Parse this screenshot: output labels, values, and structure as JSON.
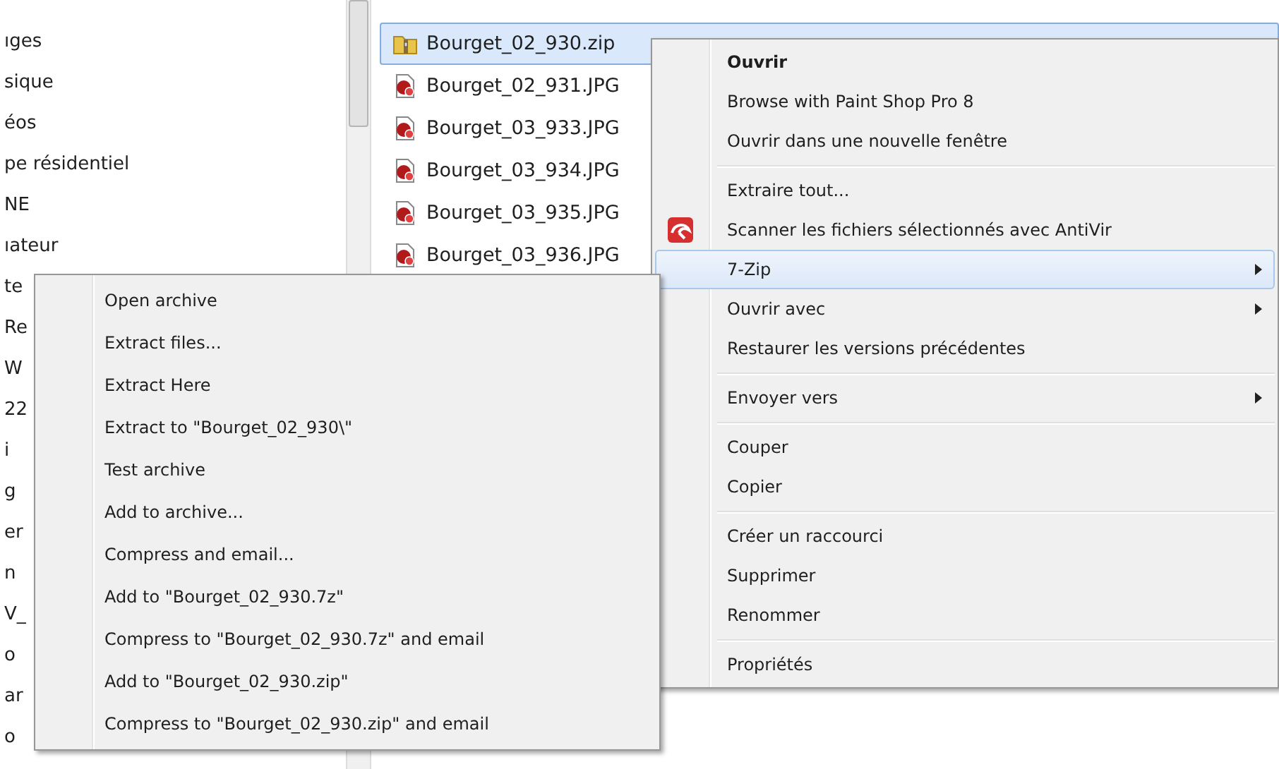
{
  "sidebar": {
    "items": [
      {
        "label": "ıges"
      },
      {
        "label": "sique"
      },
      {
        "label": "éos"
      },
      {
        "label": "pe résidentiel"
      },
      {
        "label": "NE"
      },
      {
        "label": "ıateur"
      },
      {
        "label": "te"
      },
      {
        "label": "Re"
      },
      {
        "label": "W"
      },
      {
        "label": "22"
      },
      {
        "label": "i"
      },
      {
        "label": "g"
      },
      {
        "label": "er"
      },
      {
        "label": "n"
      },
      {
        "label": "V_"
      },
      {
        "label": "o"
      },
      {
        "label": "ar"
      },
      {
        "label": "o"
      }
    ]
  },
  "file_list": {
    "rows": [
      {
        "name": "Bourget_02_930.zip",
        "kind": "zip",
        "selected": true
      },
      {
        "name": "Bourget_02_931.JPG",
        "kind": "image",
        "selected": false
      },
      {
        "name": "Bourget_03_933.JPG",
        "kind": "image",
        "selected": false
      },
      {
        "name": "Bourget_03_934.JPG",
        "kind": "image",
        "selected": false
      },
      {
        "name": "Bourget_03_935.JPG",
        "kind": "image",
        "selected": false
      },
      {
        "name": "Bourget_03_936.JPG",
        "kind": "image",
        "selected": false
      }
    ]
  },
  "context_menu": {
    "groups": [
      [
        {
          "label": "Ouvrir",
          "bold": true,
          "icon": false,
          "submenu": false,
          "selected": false
        },
        {
          "label": "Browse with Paint Shop Pro 8",
          "bold": false,
          "icon": false,
          "submenu": false,
          "selected": false
        },
        {
          "label": "Ouvrir dans une nouvelle fenêtre",
          "bold": false,
          "icon": false,
          "submenu": false,
          "selected": false
        }
      ],
      [
        {
          "label": "Extraire tout...",
          "bold": false,
          "icon": false,
          "submenu": false,
          "selected": false
        },
        {
          "label": "Scanner les fichiers sélectionnés avec AntiVir",
          "bold": false,
          "icon": true,
          "submenu": false,
          "selected": false
        },
        {
          "label": "7-Zip",
          "bold": false,
          "icon": false,
          "submenu": true,
          "selected": true
        },
        {
          "label": "Ouvrir avec",
          "bold": false,
          "icon": false,
          "submenu": true,
          "selected": false
        },
        {
          "label": "Restaurer les versions précédentes",
          "bold": false,
          "icon": false,
          "submenu": false,
          "selected": false
        }
      ],
      [
        {
          "label": "Envoyer vers",
          "bold": false,
          "icon": false,
          "submenu": true,
          "selected": false
        }
      ],
      [
        {
          "label": "Couper",
          "bold": false,
          "icon": false,
          "submenu": false,
          "selected": false
        },
        {
          "label": "Copier",
          "bold": false,
          "icon": false,
          "submenu": false,
          "selected": false
        }
      ],
      [
        {
          "label": "Créer un raccourci",
          "bold": false,
          "icon": false,
          "submenu": false,
          "selected": false
        },
        {
          "label": "Supprimer",
          "bold": false,
          "icon": false,
          "submenu": false,
          "selected": false
        },
        {
          "label": "Renommer",
          "bold": false,
          "icon": false,
          "submenu": false,
          "selected": false
        }
      ],
      [
        {
          "label": "Propriétés",
          "bold": false,
          "icon": false,
          "submenu": false,
          "selected": false
        }
      ]
    ]
  },
  "submenu": {
    "items": [
      {
        "label": "Open archive"
      },
      {
        "label": "Extract files..."
      },
      {
        "label": "Extract Here"
      },
      {
        "label": "Extract to \"Bourget_02_930\\\""
      },
      {
        "label": "Test archive"
      },
      {
        "label": "Add to archive..."
      },
      {
        "label": "Compress and email..."
      },
      {
        "label": "Add to \"Bourget_02_930.7z\""
      },
      {
        "label": "Compress to \"Bourget_02_930.7z\" and email"
      },
      {
        "label": "Add to \"Bourget_02_930.zip\""
      },
      {
        "label": "Compress to \"Bourget_02_930.zip\" and email"
      }
    ]
  }
}
